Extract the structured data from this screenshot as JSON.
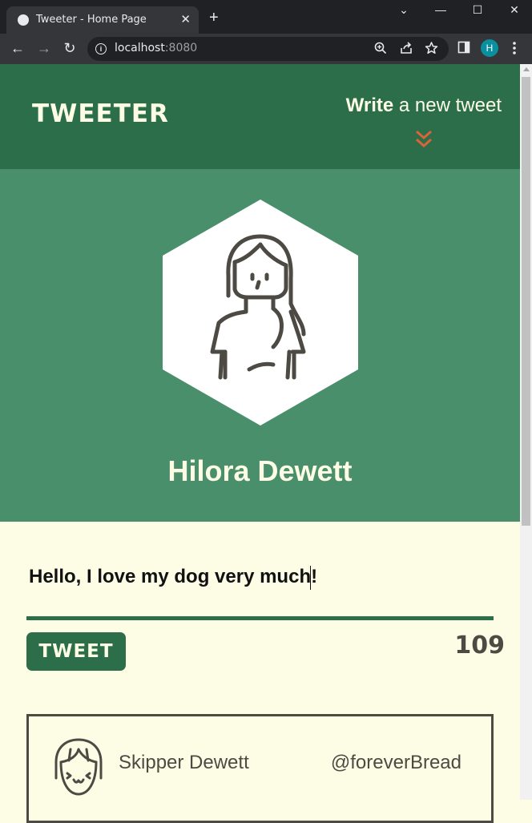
{
  "browser": {
    "tab_title": "Tweeter - Home Page",
    "tab_close": "✕",
    "new_tab": "+",
    "url_host": "localhost",
    "url_port": ":8080",
    "profile_initial": "H",
    "window_controls": [
      "⌄",
      "—",
      "☐",
      "✕"
    ],
    "nav_icons": [
      "←",
      "→",
      "↻"
    ],
    "info_icon": "i"
  },
  "nav": {
    "logo": "Tweeter",
    "write_bold": "Write",
    "write_rest": " a new tweet"
  },
  "profile": {
    "name": "Hilora Dewett"
  },
  "compose": {
    "text": "Hello, I love my dog very much!",
    "button_label": "Tweet",
    "char_counter": "109"
  },
  "tweets": [
    {
      "name": "Skipper Dewett",
      "handle": "@foreverBread"
    }
  ],
  "colors": {
    "nav_bg": "#2c6e49",
    "hero_bg": "#4a8f6b",
    "page_bg": "#fdfde6",
    "accent_chevron": "#d9643a",
    "text_dark": "#4d4a44"
  }
}
